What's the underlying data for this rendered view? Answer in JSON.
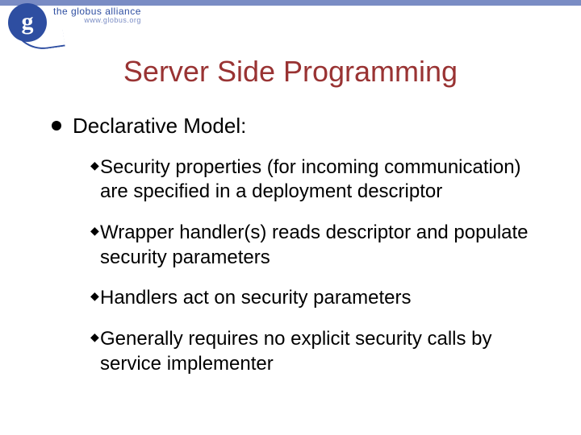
{
  "logo": {
    "glyph": "g",
    "title": "the globus alliance",
    "url": "www.globus.org"
  },
  "title": "Server Side Programming",
  "l1_text": "Declarative Model:",
  "bullets": [
    "Security properties (for incoming communication) are specified in a deployment descriptor",
    "Wrapper handler(s) reads descriptor and populate security parameters",
    "Handlers act on security parameters",
    "Generally requires no explicit security calls by service implementer"
  ]
}
